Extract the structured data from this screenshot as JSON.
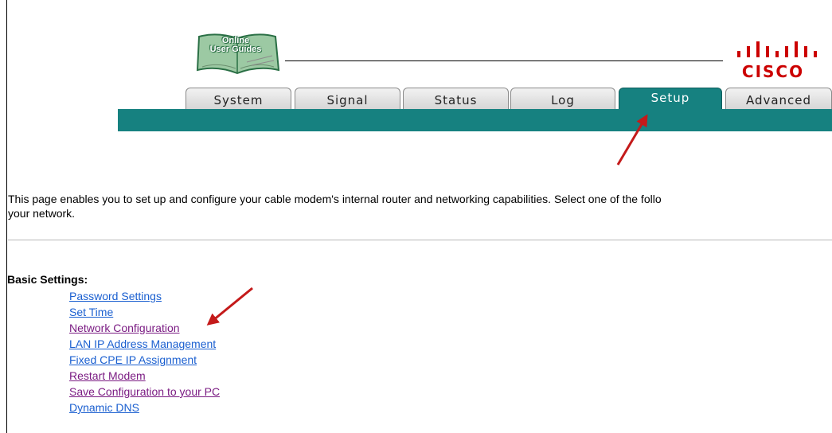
{
  "header": {
    "guides_logo_text": [
      "Online",
      "User Guides"
    ],
    "brand_name": "CISCO"
  },
  "tabs": [
    {
      "label": "System",
      "active": false
    },
    {
      "label": "Signal",
      "active": false
    },
    {
      "label": "Status",
      "active": false
    },
    {
      "label": "Log",
      "active": false
    },
    {
      "label": "Setup",
      "active": true
    },
    {
      "label": "Advanced",
      "active": false
    }
  ],
  "intro_text": [
    "This page enables you to set up and configure your cable modem's internal router and networking capabilities.  Select one of the follo",
    "your network."
  ],
  "basic_settings": {
    "title": "Basic Settings:",
    "links": [
      {
        "label": "Password Settings",
        "visited": false
      },
      {
        "label": "Set Time",
        "visited": false
      },
      {
        "label": "Network Configuration",
        "visited": true
      },
      {
        "label": "LAN IP Address Management",
        "visited": false
      },
      {
        "label": "Fixed CPE IP Assignment",
        "visited": false
      },
      {
        "label": "Restart Modem",
        "visited": true
      },
      {
        "label": "Save Configuration to your PC",
        "visited": true
      },
      {
        "label": "Dynamic DNS",
        "visited": false
      }
    ]
  },
  "colors": {
    "teal": "#168180",
    "link_unvisited": "#1a5fd0",
    "link_visited": "#7b1c83",
    "annotation_arrow": "#c41a1a",
    "cisco_red": "#cc0000"
  }
}
